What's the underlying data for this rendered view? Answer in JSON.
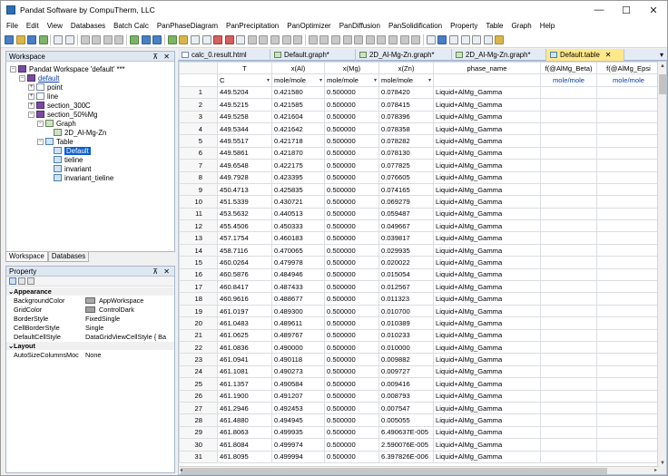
{
  "window": {
    "title": "Pandat Software by CompuTherm, LLC",
    "min": "—",
    "max": "☐",
    "close": "✕"
  },
  "menu": [
    "File",
    "Edit",
    "View",
    "Databases",
    "Batch Calc",
    "PanPhaseDiagram",
    "PanPrecipitation",
    "PanOptimizer",
    "PanDiffusion",
    "PanSolidification",
    "Property",
    "Table",
    "Graph",
    "Help"
  ],
  "workspace": {
    "title": "Workspace",
    "pin": "⊼ ✕",
    "root": "Pandat Workspace 'default' ***",
    "items": [
      {
        "label": "default",
        "expand": "−"
      },
      {
        "label": "point",
        "expand": "+"
      },
      {
        "label": "line",
        "expand": "+"
      },
      {
        "label": "section_300C",
        "expand": "+"
      },
      {
        "label": "section_50%Mg",
        "expand": "−"
      },
      {
        "label": "Graph",
        "expand": "−"
      },
      {
        "label": "2D_Al-Mg-Zn",
        "expand": ""
      },
      {
        "label": "Table",
        "expand": "−"
      },
      {
        "label": "Default",
        "expand": ""
      },
      {
        "label": "tieline",
        "expand": ""
      },
      {
        "label": "invariant",
        "expand": ""
      },
      {
        "label": "invariant_tieline",
        "expand": ""
      }
    ]
  },
  "bottom_tabs": [
    "Workspace",
    "Databases"
  ],
  "property": {
    "title": "Property",
    "pin": "⊼ ✕",
    "categories": {
      "appearance": "Appearance",
      "layout": "Layout"
    },
    "rows": [
      {
        "name": "BackgroundColor",
        "value": "AppWorkspace",
        "color": "#a9a9a9"
      },
      {
        "name": "GridColor",
        "value": "ControlDark",
        "color": "#a0a0a0"
      },
      {
        "name": "BorderStyle",
        "value": "FixedSingle"
      },
      {
        "name": "CellBorderStyle",
        "value": "Single"
      },
      {
        "name": "DefaultCellStyle",
        "value": "DataGridViewCellStyle { Ba"
      },
      {
        "name": "AutoSizeColumnsMoc",
        "value": "None"
      }
    ]
  },
  "tabs": [
    {
      "label": "calc_0.result.html",
      "active": false
    },
    {
      "label": "Default.graph*",
      "active": false
    },
    {
      "label": "2D_Al-Mg-Zn.graph*",
      "active": false
    },
    {
      "label": "2D_Al-Mg-Zn.graph*",
      "active": false
    },
    {
      "label": "Default.table",
      "active": true
    }
  ],
  "tab_close": "✕",
  "tab_menu": "▾",
  "table": {
    "headers": [
      "T",
      "x(Al)",
      "x(Mg)",
      "x(Zn)",
      "phase_name",
      "f(@AlMg_Beta)",
      "f(@AlMg_Epsi"
    ],
    "units": [
      "C",
      "mole/mole",
      "mole/mole",
      "mole/mole",
      "",
      "mole/mole",
      "mole/mole"
    ],
    "rows": [
      [
        "1",
        "449.5204",
        "0.421580",
        "0.500000",
        "0.078420",
        "Liquid+AlMg_Gamma"
      ],
      [
        "2",
        "449.5215",
        "0.421585",
        "0.500000",
        "0.078415",
        "Liquid+AlMg_Gamma"
      ],
      [
        "3",
        "449.5258",
        "0.421604",
        "0.500000",
        "0.078396",
        "Liquid+AlMg_Gamma"
      ],
      [
        "4",
        "449.5344",
        "0.421642",
        "0.500000",
        "0.078358",
        "Liquid+AlMg_Gamma"
      ],
      [
        "5",
        "449.5517",
        "0.421718",
        "0.500000",
        "0.078282",
        "Liquid+AlMg_Gamma"
      ],
      [
        "6",
        "449.5861",
        "0.421870",
        "0.500000",
        "0.078130",
        "Liquid+AlMg_Gamma"
      ],
      [
        "7",
        "449.6548",
        "0.422175",
        "0.500000",
        "0.077825",
        "Liquid+AlMg_Gamma"
      ],
      [
        "8",
        "449.7928",
        "0.423395",
        "0.500000",
        "0.076605",
        "Liquid+AlMg_Gamma"
      ],
      [
        "9",
        "450.4713",
        "0.425835",
        "0.500000",
        "0.074165",
        "Liquid+AlMg_Gamma"
      ],
      [
        "10",
        "451.5339",
        "0.430721",
        "0.500000",
        "0.069279",
        "Liquid+AlMg_Gamma"
      ],
      [
        "11",
        "453.5632",
        "0.440513",
        "0.500000",
        "0.059487",
        "Liquid+AlMg_Gamma"
      ],
      [
        "12",
        "455.4506",
        "0.450333",
        "0.500000",
        "0.049667",
        "Liquid+AlMg_Gamma"
      ],
      [
        "13",
        "457.1754",
        "0.460183",
        "0.500000",
        "0.039817",
        "Liquid+AlMg_Gamma"
      ],
      [
        "14",
        "458.7116",
        "0.470065",
        "0.500000",
        "0.029935",
        "Liquid+AlMg_Gamma"
      ],
      [
        "15",
        "460.0264",
        "0.479978",
        "0.500000",
        "0.020022",
        "Liquid+AlMg_Gamma"
      ],
      [
        "16",
        "460.5876",
        "0.484946",
        "0.500000",
        "0.015054",
        "Liquid+AlMg_Gamma"
      ],
      [
        "17",
        "460.8417",
        "0.487433",
        "0.500000",
        "0.012567",
        "Liquid+AlMg_Gamma"
      ],
      [
        "18",
        "460.9616",
        "0.488677",
        "0.500000",
        "0.011323",
        "Liquid+AlMg_Gamma"
      ],
      [
        "19",
        "461.0197",
        "0.489300",
        "0.500000",
        "0.010700",
        "Liquid+AlMg_Gamma"
      ],
      [
        "20",
        "461.0483",
        "0.489611",
        "0.500000",
        "0.010389",
        "Liquid+AlMg_Gamma"
      ],
      [
        "21",
        "461.0625",
        "0.489767",
        "0.500000",
        "0.010233",
        "Liquid+AlMg_Gamma"
      ],
      [
        "22",
        "461.0836",
        "0.490000",
        "0.500000",
        "0.010000",
        "Liquid+AlMg_Gamma"
      ],
      [
        "23",
        "461.0941",
        "0.490118",
        "0.500000",
        "0.009882",
        "Liquid+AlMg_Gamma"
      ],
      [
        "24",
        "461.1081",
        "0.490273",
        "0.500000",
        "0.009727",
        "Liquid+AlMg_Gamma"
      ],
      [
        "25",
        "461.1357",
        "0.490584",
        "0.500000",
        "0.009416",
        "Liquid+AlMg_Gamma"
      ],
      [
        "26",
        "461.1900",
        "0.491207",
        "0.500000",
        "0.008793",
        "Liquid+AlMg_Gamma"
      ],
      [
        "27",
        "461.2946",
        "0.492453",
        "0.500000",
        "0.007547",
        "Liquid+AlMg_Gamma"
      ],
      [
        "28",
        "461.4880",
        "0.494945",
        "0.500000",
        "0.005055",
        "Liquid+AlMg_Gamma"
      ],
      [
        "29",
        "461.8063",
        "0.499935",
        "0.500000",
        "6.490637E-005",
        "Liquid+AlMg_Gamma"
      ],
      [
        "30",
        "461.8084",
        "0.499974",
        "0.500000",
        "2.590076E-005",
        "Liquid+AlMg_Gamma"
      ],
      [
        "31",
        "461.8095",
        "0.499994",
        "0.500000",
        "6.397826E-006",
        "Liquid+AlMg_Gamma"
      ]
    ]
  },
  "icons": {
    "dropdown": "▾",
    "up": "▲",
    "down": "▼",
    "left": "◂",
    "right": "▸"
  }
}
